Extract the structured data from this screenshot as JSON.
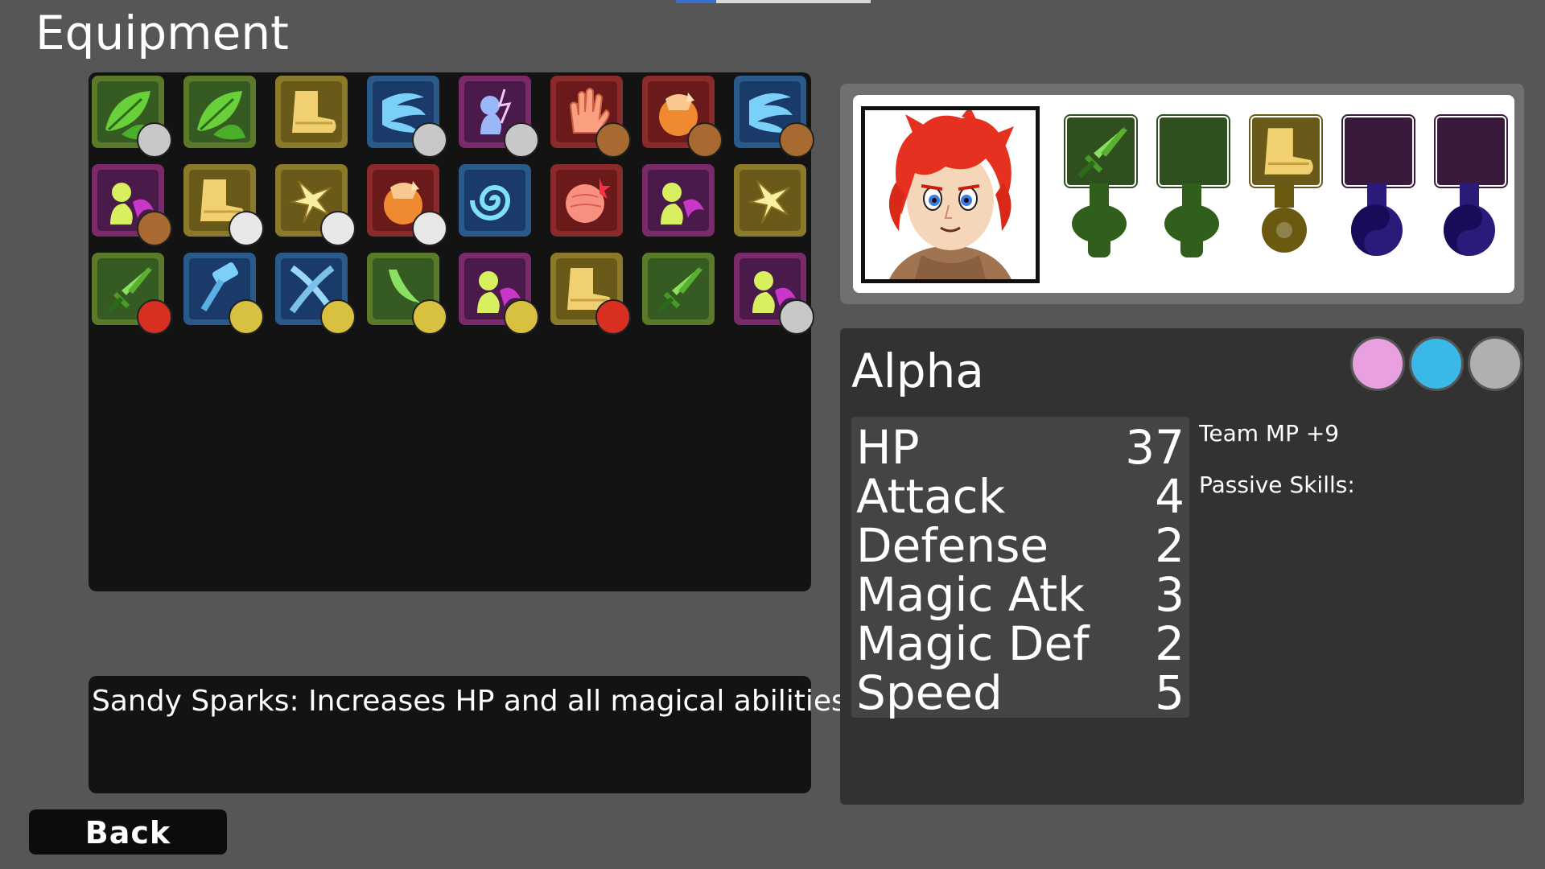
{
  "screen_title": "Equipment",
  "inventory": {
    "items": [
      {
        "icon": "leaf-icon",
        "frame": "#5a7a2a",
        "bg": "#355a22",
        "owner": "grey-creature-icon"
      },
      {
        "icon": "leaf-icon",
        "frame": "#5a7a2a",
        "bg": "#355a22",
        "owner": ""
      },
      {
        "icon": "boot-icon",
        "frame": "#8a7a2a",
        "bg": "#6a5a1a",
        "owner": ""
      },
      {
        "icon": "wind-icon",
        "frame": "#2a5a8a",
        "bg": "#1a3a6a",
        "owner": "grey-creature-icon"
      },
      {
        "icon": "lightning-spirit-icon",
        "frame": "#7a2a6a",
        "bg": "#4a1a4a",
        "owner": "grey-creature-icon"
      },
      {
        "icon": "glove-icon",
        "frame": "#8a2a2a",
        "bg": "#6a1a1a",
        "owner": "brown-hair-girl-icon"
      },
      {
        "icon": "fist-icon",
        "frame": "#8a2a2a",
        "bg": "#6a1a1a",
        "owner": "brown-hair-girl-icon"
      },
      {
        "icon": "wind-icon",
        "frame": "#2a5a8a",
        "bg": "#1a3a6a",
        "owner": "brown-hair-girl-icon"
      },
      {
        "icon": "spirit-icon",
        "frame": "#7a2a6a",
        "bg": "#4a1a4a",
        "owner": "brown-hair-girl-icon"
      },
      {
        "icon": "boot-icon",
        "frame": "#8a7a2a",
        "bg": "#6a5a1a",
        "owner": "panda-icon"
      },
      {
        "icon": "sparks-icon",
        "frame": "#8a7a2a",
        "bg": "#6a5a1a",
        "owner": "panda-icon"
      },
      {
        "icon": "fist-icon",
        "frame": "#8a2a2a",
        "bg": "#6a1a1a",
        "owner": "panda-icon"
      },
      {
        "icon": "swirl-icon",
        "frame": "#2a5a8a",
        "bg": "#1a3a6a",
        "owner": ""
      },
      {
        "icon": "orb-icon",
        "frame": "#8a2a2a",
        "bg": "#6a1a1a",
        "owner": ""
      },
      {
        "icon": "spirit-icon",
        "frame": "#7a2a6a",
        "bg": "#4a1a4a",
        "owner": ""
      },
      {
        "icon": "sparks-icon",
        "frame": "#8a7a2a",
        "bg": "#6a5a1a",
        "owner": ""
      },
      {
        "icon": "sword-icon",
        "frame": "#5a7a2a",
        "bg": "#355a22",
        "owner": "red-hair-hero-icon"
      },
      {
        "icon": "hammer-icon",
        "frame": "#2a5a8a",
        "bg": "#1a3a6a",
        "owner": "goblin-icon"
      },
      {
        "icon": "cross-blades-icon",
        "frame": "#2a5a8a",
        "bg": "#1a3a6a",
        "owner": "goblin-icon"
      },
      {
        "icon": "scimitar-icon",
        "frame": "#5a7a2a",
        "bg": "#355a22",
        "owner": "goblin-icon"
      },
      {
        "icon": "spirit-icon",
        "frame": "#7a2a6a",
        "bg": "#4a1a4a",
        "owner": "goblin-icon"
      },
      {
        "icon": "boot-icon",
        "frame": "#8a7a2a",
        "bg": "#6a5a1a",
        "owner": "red-hair-hero-icon"
      },
      {
        "icon": "sword-icon",
        "frame": "#5a7a2a",
        "bg": "#355a22",
        "owner": ""
      },
      {
        "icon": "spirit-icon",
        "frame": "#7a2a6a",
        "bg": "#4a1a4a",
        "owner": "grey-creature-icon"
      }
    ]
  },
  "description": "Sandy Sparks: Increases HP and all magical abilities.",
  "back_label": "Back",
  "character": {
    "name": "Alpha",
    "portrait": "red-hair-hero-portrait",
    "abilities": [
      {
        "icon": "pink-creature-icon",
        "color": "#e8a0e0"
      },
      {
        "icon": "blue-fist-icon",
        "color": "#3ab8e8"
      },
      {
        "icon": "grey-hexagon-icon",
        "color": "#b0b0b0"
      }
    ],
    "equipment_slots": [
      {
        "type": "weapon",
        "icon": "sword-icon",
        "slot_color": "#2f4f1f",
        "gem": "mushroom-icon",
        "gem_color": "#2f5f1a"
      },
      {
        "type": "weapon",
        "icon": "",
        "slot_color": "#2f4f1f",
        "gem": "mushroom-icon",
        "gem_color": "#2f5f1a"
      },
      {
        "type": "armor",
        "icon": "boot-icon",
        "slot_color": "#6a5a1a",
        "gem": "gear-icon",
        "gem_color": "#6a5a10"
      },
      {
        "type": "accessory",
        "icon": "",
        "slot_color": "#3a1a3a",
        "gem": "yin-yang-icon",
        "gem_color": "#2a1a7a"
      },
      {
        "type": "accessory",
        "icon": "",
        "slot_color": "#3a1a3a",
        "gem": "yin-yang-icon",
        "gem_color": "#2a1a7a"
      }
    ],
    "stats": [
      {
        "label": "HP",
        "value": "37"
      },
      {
        "label": "Attack",
        "value": "4"
      },
      {
        "label": "Defense",
        "value": "2"
      },
      {
        "label": "Magic Atk",
        "value": "3"
      },
      {
        "label": "Magic Def",
        "value": "2"
      },
      {
        "label": "Speed",
        "value": "5"
      }
    ],
    "team_bonus": "Team MP +9",
    "passive_skills_label": "Passive Skills:"
  }
}
